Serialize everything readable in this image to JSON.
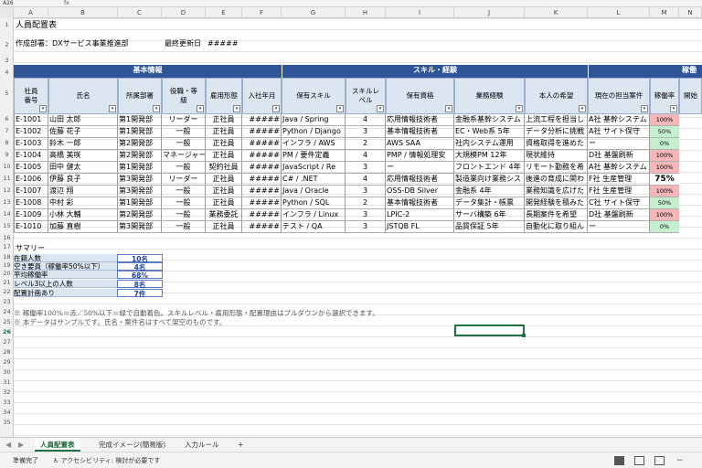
{
  "formula_bar": {
    "name_box": "A26",
    "fx": "fx"
  },
  "columns": [
    "A",
    "B",
    "C",
    "D",
    "E",
    "F",
    "G",
    "H",
    "I",
    "J",
    "K",
    "L",
    "M",
    "N"
  ],
  "rows": [
    "1",
    "2",
    "3",
    "4",
    "5",
    "6",
    "7",
    "8",
    "9",
    "10",
    "11",
    "12",
    "13",
    "14",
    "15",
    "16",
    "17",
    "18",
    "19",
    "20",
    "21",
    "22",
    "23",
    "24",
    "25",
    "26",
    "27",
    "28",
    "29",
    "30",
    "31",
    "32",
    "33",
    "34",
    "35"
  ],
  "sheet": {
    "title": "人員配置表",
    "created_by": "作成部署：DXサービス事業推進部",
    "last_updated_label": "最終更新日",
    "last_updated_value": "#####",
    "band_basic": "基本情報",
    "band_skill": "スキル・経験",
    "band_util": "稼働",
    "headers": {
      "id": "社員番号",
      "name": "氏名",
      "dept": "所属部署",
      "role": "役職・等級",
      "employment": "雇用形態",
      "join": "入社年月",
      "skill": "保有スキル",
      "level": "スキルレベル",
      "cert": "保有資格",
      "experience": "業務経験",
      "wish": "本人の希望",
      "project": "現在の担当案件",
      "rate": "稼働率",
      "extra": "開始"
    },
    "employees": [
      {
        "id": "E-1001",
        "name": "山田 太郎",
        "dept": "第1開発部",
        "role": "リーダー",
        "employment": "正社員",
        "join": "#####",
        "skill": "Java / Spring",
        "level": "4",
        "cert": "応用情報技術者",
        "experience": "金融系基幹システム",
        "wish": "上流工程を担当し",
        "project": "A社 基幹システム",
        "rate": "100%",
        "rate_color": "#f4b6b6"
      },
      {
        "id": "E-1002",
        "name": "佐藤 花子",
        "dept": "第1開発部",
        "role": "一般",
        "employment": "正社員",
        "join": "#####",
        "skill": "Python / Django",
        "level": "3",
        "cert": "基本情報技術者",
        "experience": "EC・Web系 5年",
        "wish": "データ分析に挑戦",
        "project": "A社 サイト保守",
        "rate": "50%",
        "rate_color": "#c6efce"
      },
      {
        "id": "E-1003",
        "name": "鈴木 一郎",
        "dept": "第2開発部",
        "role": "一般",
        "employment": "正社員",
        "join": "#####",
        "skill": "インフラ / AWS",
        "level": "2",
        "cert": "AWS SAA",
        "experience": "社内システム運用",
        "wish": "資格取得を進めた",
        "project": "ー",
        "rate": "0%",
        "rate_color": "#c6efce"
      },
      {
        "id": "E-1004",
        "name": "高橋 美咲",
        "dept": "第2開発部",
        "role": "マネージャー",
        "employment": "正社員",
        "join": "#####",
        "skill": "PM / 要件定義",
        "level": "4",
        "cert": "PMP / 情報処理安",
        "experience": "大規模PM 12年",
        "wish": "現状維持",
        "project": "D社 基盤刷新",
        "rate": "100%",
        "rate_color": "#f4b6b6"
      },
      {
        "id": "E-1005",
        "name": "田中 健太",
        "dept": "第1開発部",
        "role": "一般",
        "employment": "契約社員",
        "join": "#####",
        "skill": "JavaScript / Re",
        "level": "3",
        "cert": "ー",
        "experience": "フロントエンド 4年",
        "wish": "リモート勤務を希",
        "project": "A社 基幹システム",
        "rate": "100%",
        "rate_color": "#f4b6b6"
      },
      {
        "id": "E-1006",
        "name": "伊藤 良子",
        "dept": "第3開発部",
        "role": "リーダー",
        "employment": "正社員",
        "join": "#####",
        "skill": "C# / .NET",
        "level": "4",
        "cert": "応用情報技術者",
        "experience": "製造業向け業務シス",
        "wish": "後進の育成に関わ",
        "project": "F社 生産管理",
        "rate": "75%",
        "rate_color": "#ffffff"
      },
      {
        "id": "E-1007",
        "name": "渡辺 翔",
        "dept": "第3開発部",
        "role": "一般",
        "employment": "正社員",
        "join": "#####",
        "skill": "Java / Oracle",
        "level": "3",
        "cert": "OSS-DB Silver",
        "experience": "金融系 4年",
        "wish": "業務知識を広げた",
        "project": "F社 生産管理",
        "rate": "100%",
        "rate_color": "#f4b6b6"
      },
      {
        "id": "E-1008",
        "name": "中村 彩",
        "dept": "第1開発部",
        "role": "一般",
        "employment": "正社員",
        "join": "#####",
        "skill": "Python / SQL",
        "level": "2",
        "cert": "基本情報技術者",
        "experience": "データ集計・帳票",
        "wish": "開発経験を積みた",
        "project": "C社 サイト保守",
        "rate": "50%",
        "rate_color": "#c6efce"
      },
      {
        "id": "E-1009",
        "name": "小林 大輔",
        "dept": "第2開発部",
        "role": "一般",
        "employment": "業務委託",
        "join": "#####",
        "skill": "インフラ / Linux",
        "level": "3",
        "cert": "LPIC-2",
        "experience": "サーバ構築 6年",
        "wish": "長期案件を希望",
        "project": "D社 基盤刷新",
        "rate": "100%",
        "rate_color": "#f4b6b6"
      },
      {
        "id": "E-1010",
        "name": "加藤 直樹",
        "dept": "第3開発部",
        "role": "一般",
        "employment": "正社員",
        "join": "#####",
        "skill": "テスト / QA",
        "level": "3",
        "cert": "JSTQB FL",
        "experience": "品質保証 5年",
        "wish": "自動化に取り組ん",
        "project": "ー",
        "rate": "0%",
        "rate_color": "#c6efce"
      }
    ],
    "summary_title": "サマリー",
    "summary": [
      {
        "label": "在籍人数",
        "value": "10名"
      },
      {
        "label": "空き要員（稼働率50%以下）",
        "value": "4名"
      },
      {
        "label": "平均稼働率",
        "value": "68%"
      },
      {
        "label": "レベル3以上の人数",
        "value": "8名"
      },
      {
        "label": "配置計画あり",
        "value": "7件"
      }
    ],
    "notes": [
      "※ 稼働率100%＝赤／50%以下＝緑で自動着色。スキルレベル・雇用形態・配置理由はプルダウンから選択できます。",
      "※ 本データはサンプルです。氏名・案件名はすべて架空のものです。"
    ]
  },
  "tabs": {
    "active": "人員配置表",
    "tab2": "完成イメージ(簡易版)",
    "tab3": "入力ルール",
    "add": "+"
  },
  "status": {
    "ready": "準備完了",
    "accessibility": "アクセシビリティ: 検討が必要です"
  },
  "colors": {
    "band": "#2f5597",
    "header_fill": "#dce6f1",
    "rate_red": "#f4b6b6",
    "rate_green": "#c6efce",
    "excel_green": "#217346"
  }
}
